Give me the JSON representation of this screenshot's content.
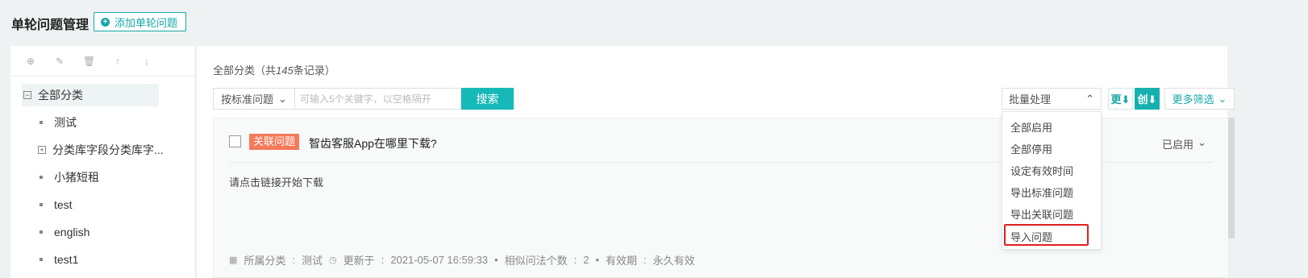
{
  "header": {
    "title": "单轮问题管理",
    "add_button_label": "添加单轮问题"
  },
  "sidebar": {
    "toolbar_icons": [
      "add-icon",
      "edit-icon",
      "delete-icon",
      "move-up-icon",
      "move-down-icon"
    ],
    "items": [
      {
        "label": "全部分类",
        "expander": "−"
      },
      {
        "label": "测试"
      },
      {
        "label": "分类库字段分类库字...",
        "expander": "+"
      },
      {
        "label": "小猪短租"
      },
      {
        "label": "test"
      },
      {
        "label": "english"
      },
      {
        "label": "test1"
      }
    ]
  },
  "main": {
    "record_prefix": "全部分类（共",
    "record_count": "145",
    "record_suffix": "条记录）",
    "search": {
      "type_label": "按标准问题",
      "placeholder": "可输入5个关键字，以空格隔开",
      "button_label": "搜索"
    },
    "batch": {
      "label": "批量处理",
      "options": [
        "全部启用",
        "全部停用",
        "设定有效时间",
        "导出标准问题",
        "导出关联问题",
        "导入问题"
      ]
    },
    "sort_update_label": "更⬇",
    "sort_create_label": "创⬇",
    "more_filter_label": "更多筛选"
  },
  "card": {
    "tag": "关联问题",
    "question": "智齿客服App在哪里下载?",
    "status": "已启用",
    "answer": "请点击链接开始下载",
    "meta": {
      "category_label": "所属分类",
      "category_value": "测试",
      "updated_label": "更新于",
      "updated_value": "2021-05-07 16:59:33",
      "similar_label": "相似问法个数",
      "similar_value": "2",
      "validity_label": "有效期",
      "validity_value": "永久有效"
    }
  },
  "colors": {
    "accent": "#17b8b8",
    "tag": "#f47a5a",
    "highlight": "#e02020"
  }
}
